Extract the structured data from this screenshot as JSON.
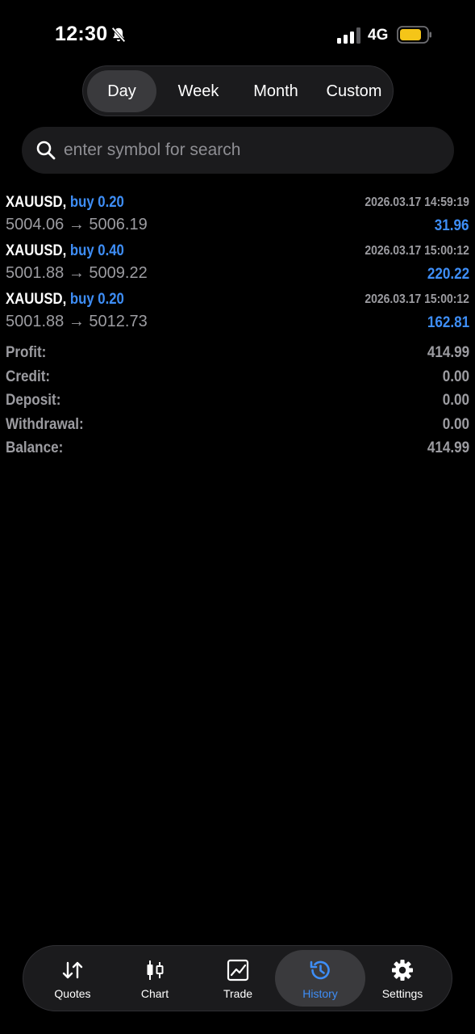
{
  "status_bar": {
    "time": "12:30",
    "network": "4G",
    "battery_color": "#f5c518"
  },
  "period_tabs": [
    {
      "label": "Day",
      "active": true
    },
    {
      "label": "Week",
      "active": false
    },
    {
      "label": "Month",
      "active": false
    },
    {
      "label": "Custom",
      "active": false
    }
  ],
  "search": {
    "placeholder": "enter symbol for search",
    "value": ""
  },
  "deals": [
    {
      "symbol": "XAUUSD,",
      "side": "buy 0.20",
      "time": "2026.03.17 14:59:19",
      "prices": "5004.06 → 5006.19",
      "profit": "31.96"
    },
    {
      "symbol": "XAUUSD,",
      "side": "buy 0.40",
      "time": "2026.03.17 15:00:12",
      "prices": "5001.88 → 5009.22",
      "profit": "220.22"
    },
    {
      "symbol": "XAUUSD,",
      "side": "buy 0.20",
      "time": "2026.03.17 15:00:12",
      "prices": "5001.88 → 5012.73",
      "profit": "162.81"
    }
  ],
  "summary": [
    {
      "label": "Profit:",
      "value": "414.99"
    },
    {
      "label": "Credit:",
      "value": "0.00"
    },
    {
      "label": "Deposit:",
      "value": "0.00"
    },
    {
      "label": "Withdrawal:",
      "value": "0.00"
    },
    {
      "label": "Balance:",
      "value": "414.99"
    }
  ],
  "nav": [
    {
      "label": "Quotes",
      "icon": "quotes-arrows-icon"
    },
    {
      "label": "Chart",
      "icon": "candlestick-icon"
    },
    {
      "label": "Trade",
      "icon": "trade-chart-icon"
    },
    {
      "label": "History",
      "icon": "history-clock-icon",
      "active": true
    },
    {
      "label": "Settings",
      "icon": "gear-icon"
    }
  ],
  "colors": {
    "accent": "#3e8ef7",
    "muted": "#9c9ca1",
    "background": "#000000",
    "panel": "#1b1b1d"
  }
}
